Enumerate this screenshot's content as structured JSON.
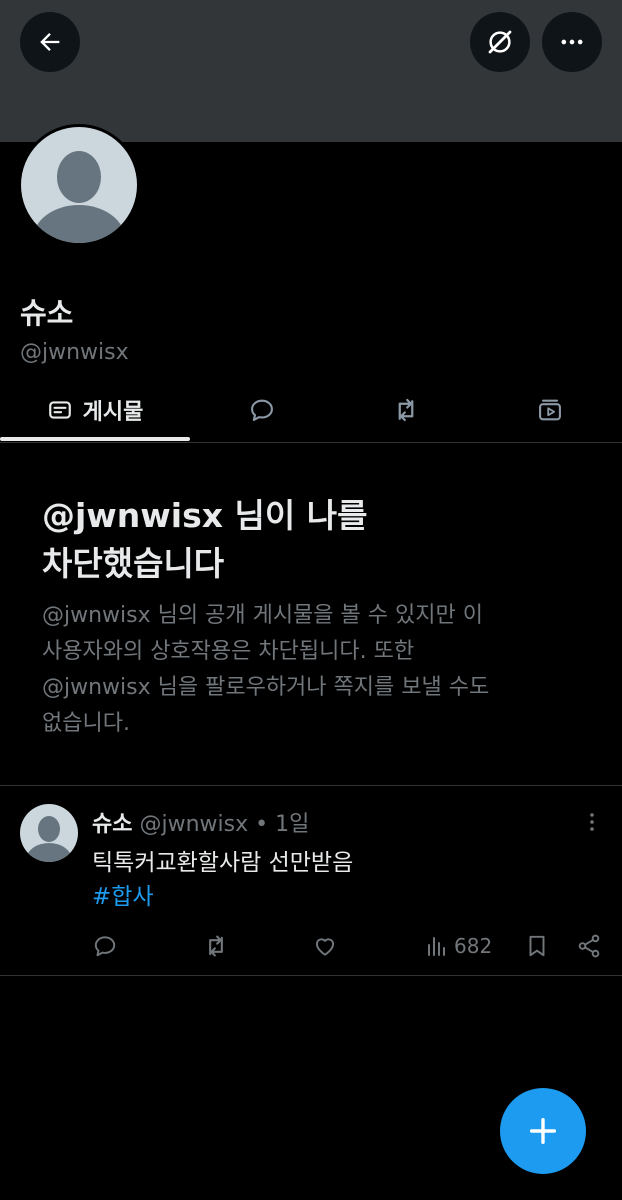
{
  "header": {
    "back_icon": "arrow-left-icon",
    "grok_icon": "grok-icon",
    "more_icon": "more-horizontal-icon"
  },
  "profile": {
    "display_name": "슈소",
    "handle": "@jwnwisx"
  },
  "tabs": [
    {
      "label": "게시물",
      "icon": "posts-icon",
      "active": true
    },
    {
      "label": "",
      "icon": "replies-icon",
      "active": false
    },
    {
      "label": "",
      "icon": "reposts-icon",
      "active": false
    },
    {
      "label": "",
      "icon": "media-icon",
      "active": false
    }
  ],
  "blocked": {
    "title_line1": "@jwnwisx 님이 나를",
    "title_line2": "차단했습니다",
    "desc_line1": "@jwnwisx 님의 공개 게시물을 볼 수 있지만 이",
    "desc_line2": "사용자와의 상호작용은 차단됩니다. 또한",
    "desc_line3": "@jwnwisx 님을 팔로우하거나 쪽지를 보낼 수도",
    "desc_line4": "없습니다."
  },
  "post": {
    "name": "슈소",
    "handle": "@jwnwisx",
    "separator": " • ",
    "time": "1일",
    "text": "틱톡커교환할사람 선만받음",
    "hashtag": "#합사",
    "views": "682"
  },
  "colors": {
    "background": "#000000",
    "banner": "#333639",
    "primary_text": "#e7e9ea",
    "secondary_text": "#71767b",
    "accent": "#1d9bf0",
    "divider": "#2f3336"
  }
}
